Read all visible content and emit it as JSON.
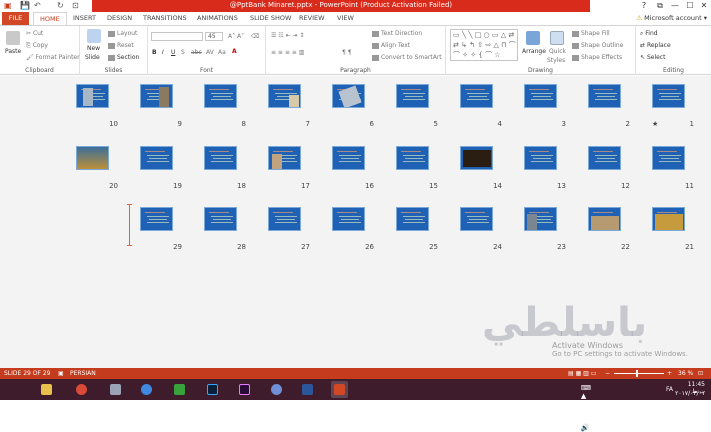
{
  "window": {
    "title": "@PptBank Minaret.pptx -  PowerPoint (Product Activation Failed)",
    "account": "Microsoft account",
    "minimize": "—",
    "maximize": "☐",
    "close": "✕",
    "help": "?",
    "restore": "⧉"
  },
  "tabs": [
    "FILE",
    "HOME",
    "INSERT",
    "DESIGN",
    "TRANSITIONS",
    "ANIMATIONS",
    "SLIDE SHOW",
    "REVIEW",
    "VIEW"
  ],
  "ribbon": {
    "clipboard": {
      "label": "Clipboard",
      "paste": "Paste",
      "cut": "Cut",
      "copy": "Copy",
      "format_painter": "Format Painter"
    },
    "slides": {
      "label": "Slides",
      "new_slide": "New",
      "new_slide2": "Slide",
      "layout": "Layout",
      "reset": "Reset",
      "section": "Section"
    },
    "font": {
      "label": "Font",
      "size": "45"
    },
    "paragraph": {
      "label": "Paragraph",
      "text_direction": "Text Direction",
      "align_text": "Align Text",
      "convert": "Convert to SmartArt"
    },
    "drawing": {
      "label": "Drawing",
      "arrange": "Arrange",
      "quick_styles": "Quick",
      "quick_styles2": "Styles",
      "shape_fill": "Shape Fill",
      "shape_outline": "Shape Outline",
      "shape_effects": "Shape Effects"
    },
    "editing": {
      "label": "Editing",
      "find": "Find",
      "replace": "Replace",
      "select": "Select"
    }
  },
  "slides": [
    {
      "n": "1",
      "pic": "none"
    },
    {
      "n": "2",
      "pic": "none"
    },
    {
      "n": "3",
      "pic": "none"
    },
    {
      "n": "4",
      "pic": "none"
    },
    {
      "n": "5",
      "pic": "none"
    },
    {
      "n": "6",
      "pic": "tilted"
    },
    {
      "n": "7",
      "pic": "small"
    },
    {
      "n": "8",
      "pic": "none"
    },
    {
      "n": "9",
      "pic": "tower"
    },
    {
      "n": "10",
      "pic": "sky"
    },
    {
      "n": "11",
      "pic": "none"
    },
    {
      "n": "12",
      "pic": "none"
    },
    {
      "n": "13",
      "pic": "none"
    },
    {
      "n": "14",
      "pic": "night"
    },
    {
      "n": "15",
      "pic": "none"
    },
    {
      "n": "16",
      "pic": "none"
    },
    {
      "n": "17",
      "pic": "column"
    },
    {
      "n": "18",
      "pic": "none"
    },
    {
      "n": "19",
      "pic": "none"
    },
    {
      "n": "20",
      "pic": "sunset"
    },
    {
      "n": "21",
      "pic": "dome"
    },
    {
      "n": "22",
      "pic": "ruins"
    },
    {
      "n": "23",
      "pic": "minaret"
    },
    {
      "n": "24",
      "pic": "none"
    },
    {
      "n": "25",
      "pic": "none"
    },
    {
      "n": "26",
      "pic": "none"
    },
    {
      "n": "27",
      "pic": "none"
    },
    {
      "n": "28",
      "pic": "none"
    },
    {
      "n": "29",
      "pic": "none"
    }
  ],
  "status": {
    "slide": "SLIDE 29 OF 29",
    "language": "PERSIAN",
    "zoom": "36 %"
  },
  "watermark": {
    "logo": "باسلطي",
    "activate1": "Activate Windows",
    "activate2": "Go to PC settings to activate Windows."
  },
  "tray": {
    "time": "11:45 ب.ظ",
    "date": "۲۰۱۷/۰۲/۰۱",
    "lang": "FA"
  },
  "colors": {
    "accent": "#d24726",
    "status": "#c43b1d",
    "slide": "#1f62b5",
    "taskbar": "#3e1c2c"
  }
}
